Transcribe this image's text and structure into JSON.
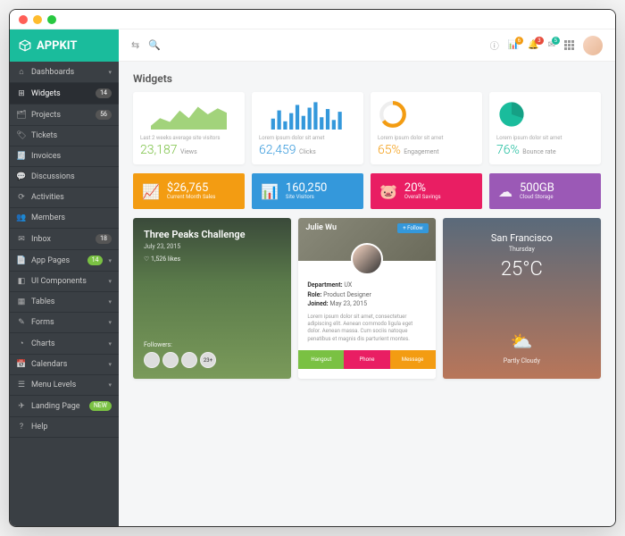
{
  "brand": "APPKIT",
  "page_title": "Widgets",
  "sidebar": [
    {
      "icon": "⌂",
      "label": "Dashboards",
      "chev": true
    },
    {
      "icon": "⊞",
      "label": "Widgets",
      "badge": "14",
      "active": true
    },
    {
      "icon": "🗂",
      "label": "Projects",
      "badge": "56"
    },
    {
      "icon": "🏷",
      "label": "Tickets"
    },
    {
      "icon": "🧾",
      "label": "Invoices"
    },
    {
      "icon": "💬",
      "label": "Discussions"
    },
    {
      "icon": "⟳",
      "label": "Activities"
    },
    {
      "icon": "👥",
      "label": "Members"
    },
    {
      "icon": "✉",
      "label": "Inbox",
      "badge": "18"
    },
    {
      "icon": "📄",
      "label": "App Pages",
      "badge": "14",
      "badgeColor": "green",
      "chev": true
    },
    {
      "icon": "◧",
      "label": "UI Components",
      "chev": true
    },
    {
      "icon": "▦",
      "label": "Tables",
      "chev": true
    },
    {
      "icon": "✎",
      "label": "Forms",
      "chev": true
    },
    {
      "icon": "◔",
      "label": "Charts",
      "chev": true
    },
    {
      "icon": "📅",
      "label": "Calendars",
      "chev": true
    },
    {
      "icon": "☰",
      "label": "Menu Levels",
      "chev": true
    },
    {
      "icon": "✈",
      "label": "Landing Page",
      "badge": "NEW",
      "badgeColor": "green"
    },
    {
      "icon": "?",
      "label": "Help"
    }
  ],
  "topbar_notifications": [
    {
      "icon": "ⓘ"
    },
    {
      "icon": "📊",
      "count": "6",
      "color": "orange"
    },
    {
      "icon": "🔔",
      "count": "3"
    },
    {
      "icon": "✉",
      "count": "5",
      "color": "teal"
    }
  ],
  "mini_cards": [
    {
      "label": "Last 2 weeks average site visitors",
      "value": "23,187",
      "unit": "Views",
      "color": "green",
      "chart": "area"
    },
    {
      "label": "Lorem ipsum dolor sit amet",
      "value": "62,459",
      "unit": "Clicks",
      "color": "blue",
      "chart": "bars"
    },
    {
      "label": "Lorem ipsum dolor sit amet",
      "value": "65%",
      "unit": "Engagement",
      "color": "orange",
      "chart": "donut"
    },
    {
      "label": "Lorem ipsum dolor sit amet",
      "value": "76%",
      "unit": "Bounce rate",
      "color": "teal",
      "chart": "pie"
    }
  ],
  "stats": [
    {
      "icon": "📈",
      "value": "$26,765",
      "label": "Current Month Sales",
      "color": "orange"
    },
    {
      "icon": "📊",
      "value": "160,250",
      "label": "Site Visitors",
      "color": "blue"
    },
    {
      "icon": "🐷",
      "value": "20%",
      "label": "Overall Savings",
      "color": "pink"
    },
    {
      "icon": "☁",
      "value": "500GB",
      "label": "Cloud Storage",
      "color": "purple"
    }
  ],
  "challenge": {
    "title": "Three Peaks Challenge",
    "date": "July 23, 2015",
    "likes": "♡ 1,526 likes",
    "followers_label": "Followers:",
    "extra": "23+"
  },
  "profile": {
    "name": "Julie Wu",
    "follow": "+ Follow",
    "dept_label": "Department:",
    "dept": "UX",
    "role_label": "Role:",
    "role": "Product Designer",
    "joined_label": "Joined:",
    "joined": "May 23, 2015",
    "lorem": "Lorem ipsum dolor sit amet, consectetuer adipiscing elit. Aenean commodo ligula eget dolor. Aenean massa. Cum sociis natoque penatibus et magnis dis parturient montes.",
    "actions": [
      "Hangout",
      "Phone",
      "Message"
    ]
  },
  "weather": {
    "city": "San Francisco",
    "day": "Thursday",
    "temp": "25°C",
    "condition": "Partly Cloudy"
  },
  "chart_data": {
    "mini_area": {
      "type": "area",
      "values": [
        5,
        12,
        8,
        18,
        10,
        22,
        14,
        20
      ]
    },
    "mini_bars": {
      "type": "bar",
      "values": [
        8,
        14,
        6,
        12,
        18,
        10,
        16,
        20,
        9,
        15,
        7,
        13
      ]
    },
    "mini_donut": {
      "type": "pie",
      "values": [
        65,
        35
      ]
    },
    "mini_pie": {
      "type": "pie",
      "values": [
        76,
        24
      ]
    }
  }
}
